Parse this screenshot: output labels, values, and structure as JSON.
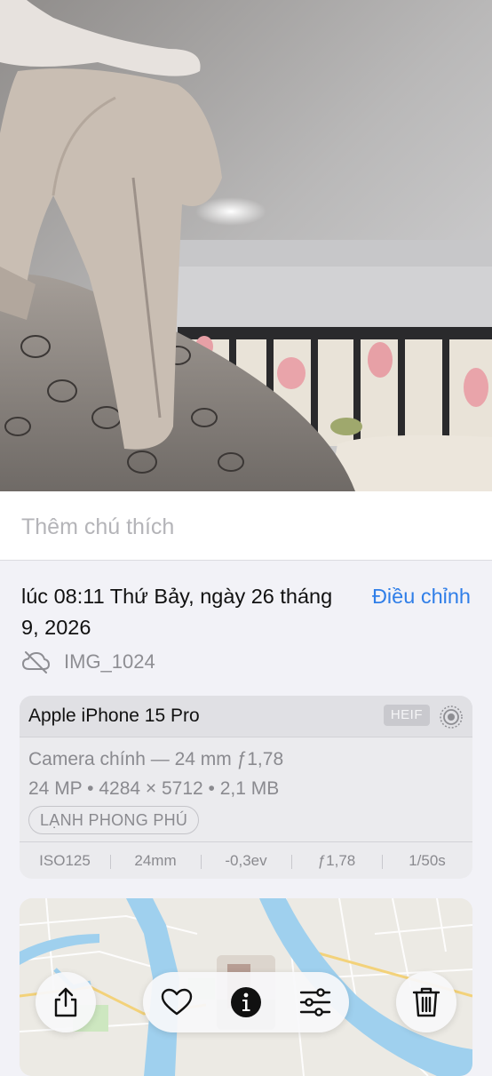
{
  "caption": {
    "placeholder": "Thêm chú thích"
  },
  "info": {
    "datetime": "lúc 08:11 Thứ Bảy, ngày 26 tháng 9, 2026",
    "adjust_label": "Điều chỉnh",
    "filename": "IMG_1024",
    "icons": {
      "cloud": "cloud-slash-icon"
    }
  },
  "camera": {
    "device": "Apple iPhone 15 Pro",
    "format": "HEIF",
    "lens": "Camera chính — 24 mm ƒ1,78",
    "specs": "24 MP • 4284 × 5712 • 2,1 MB",
    "style": "LẠNH PHONG PHÚ",
    "exif": [
      "ISO125",
      "24mm",
      "-0,3ev",
      "ƒ1,78",
      "1/50s"
    ]
  },
  "toolbar": {
    "icons": [
      "share-icon",
      "heart-icon",
      "info-icon",
      "adjust-sliders-icon",
      "trash-icon"
    ]
  },
  "colors": {
    "accent": "#2f7ee8",
    "background": "#f2f2f7",
    "map_water": "#9fd0ee"
  }
}
